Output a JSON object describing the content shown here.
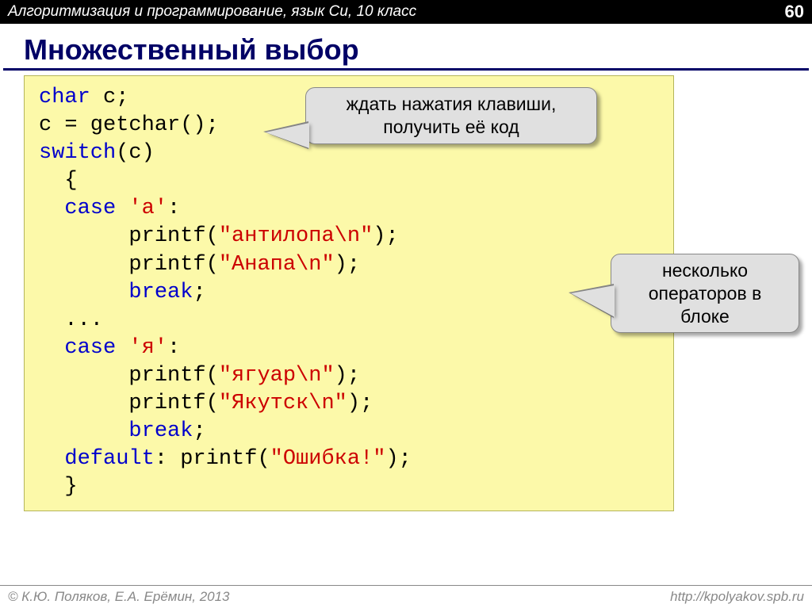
{
  "header": {
    "subject": "Алгоритмизация и программирование, язык Си, 10 класс",
    "page": "60"
  },
  "title": "Множественный выбор",
  "code": {
    "l1a": "char",
    "l1b": " c;",
    "l2a": "c = getchar();",
    "l3a": "switch",
    "l3b": "(c)",
    "l4": "  {",
    "l5a": "  case",
    "l5b": " 'а'",
    "l5c": ":",
    "l6a": "       printf(",
    "l6b": "\"антилопа\\n\"",
    "l6c": ");",
    "l7a": "       printf(",
    "l7b": "\"Анапа\\n\"",
    "l7c": ");",
    "l8a": "       break",
    "l8b": ";",
    "l9": "  ...",
    "l10a": "  case",
    "l10b": " 'я'",
    "l10c": ":",
    "l11a": "       printf(",
    "l11b": "\"ягуар\\n\"",
    "l11c": ");",
    "l12a": "       printf(",
    "l12b": "\"Якутск\\n\"",
    "l12c": ");",
    "l13a": "       break",
    "l13b": ";",
    "l14a": "  default",
    "l14b": ": printf(",
    "l14c": "\"Ошибка!\"",
    "l14d": ");",
    "l15": "  }"
  },
  "callout1_l1": "ждать нажатия клавиши,",
  "callout1_l2": "получить её код",
  "callout2_l1": "несколько",
  "callout2_l2": "операторов в",
  "callout2_l3": "блоке",
  "footer": {
    "copyright": "© К.Ю. Поляков, Е.А. Ерёмин, 2013",
    "url": "http://kpolyakov.spb.ru"
  }
}
